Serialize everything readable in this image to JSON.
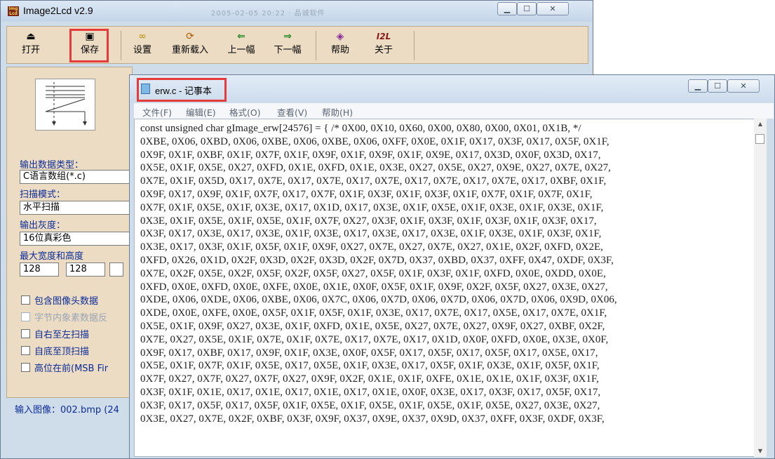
{
  "image2lcd": {
    "title": "Image2Lcd v2.9",
    "title_faded": "2005-02-05 20:22 · 品诚软件",
    "toolbar": [
      {
        "id": "open",
        "label": "打开",
        "icon": "open-icon"
      },
      {
        "id": "save",
        "label": "保存",
        "icon": "save-icon"
      },
      {
        "id": "settings",
        "label": "设置",
        "icon": "glasses-icon"
      },
      {
        "id": "reload",
        "label": "重新载入",
        "icon": "reload-icon"
      },
      {
        "id": "prev",
        "label": "上一幅",
        "icon": "left-arrow-icon"
      },
      {
        "id": "next",
        "label": "下一幅",
        "icon": "right-arrow-icon"
      },
      {
        "id": "help",
        "label": "帮助",
        "icon": "help-icon"
      },
      {
        "id": "about",
        "label": "关于",
        "icon": "about-icon"
      }
    ],
    "about_icon_text": "I2L",
    "fields": {
      "output_type_label": "输出数据类型：",
      "output_type_value": "C语言数组(*.c)",
      "scan_mode_label": "扫描模式：",
      "scan_mode_value": "水平扫描",
      "gray_label": "输出灰度：",
      "gray_value": "16位真彩色",
      "size_label": "最大宽度和高度",
      "width_value": "128",
      "height_value": "128"
    },
    "checkboxes": [
      {
        "label": "包含图像头数据",
        "enabled": true
      },
      {
        "label": "字节内象素数据反",
        "enabled": false
      },
      {
        "label": "自右至左扫描",
        "enabled": true
      },
      {
        "label": "自底至顶扫描",
        "enabled": true
      },
      {
        "label": "高位在前(MSB Fir",
        "enabled": true
      }
    ],
    "status": "输入图像：002.bmp (24"
  },
  "notepad": {
    "title": "erw.c - 记事本",
    "menu": [
      "文件(F)",
      "编辑(E)",
      "格式(O)",
      "查看(V)",
      "帮助(H)"
    ],
    "code_lines": [
      "const unsigned char gImage_erw[24576] = { /* 0X00,0X10,0X60,0X00,0X80,0X00,0X01,0X1B, */",
      "0XBE,0X06,0XBD,0X06,0XBE,0X06,0XBE,0X06,0XFF,0X0E,0X1F,0X17,0X3F,0X17,0X5F,0X1F,",
      "0X9F,0X1F,0XBF,0X1F,0X7F,0X1F,0X9F,0X1F,0X9F,0X1F,0X9E,0X17,0X3D,0X0F,0X3D,0X17,",
      "0X5E,0X1F,0X5E,0X27,0XFD,0X1E,0XFD,0X1E,0X3E,0X27,0X5E,0X27,0X9E,0X27,0X7E,0X27,",
      "0X7E,0X1F,0X5D,0X17,0X7E,0X17,0X7E,0X17,0X7E,0X17,0X7E,0X17,0X7E,0X17,0XBF,0X1F,",
      "0X9F,0X17,0X9F,0X1F,0X7F,0X17,0X7F,0X1F,0X3F,0X1F,0X3F,0X1F,0X7F,0X1F,0X7F,0X1F,",
      "0X7F,0X1F,0X5E,0X1F,0X3E,0X17,0X1D,0X17,0X3E,0X1F,0X5E,0X1F,0X3E,0X1F,0X3E,0X1F,",
      "0X3E,0X1F,0X5E,0X1F,0X5E,0X1F,0X7F,0X27,0X3F,0X1F,0X3F,0X1F,0X3F,0X1F,0X3F,0X17,",
      "0X3F,0X17,0X3E,0X17,0X3E,0X1F,0X3E,0X17,0X3E,0X17,0X3E,0X1F,0X3E,0X1F,0X3F,0X1F,",
      "0X3E,0X17,0X3F,0X1F,0X5F,0X1F,0X9F,0X27,0X7E,0X27,0X7E,0X27,0X1E,0X2F,0XFD,0X2E,",
      "0XFD,0X26,0X1D,0X2F,0X3D,0X2F,0X3D,0X2F,0X7D,0X37,0XBD,0X37,0XFF,0X47,0XDF,0X3F,",
      "0X7E,0X2F,0X5E,0X2F,0X5F,0X2F,0X5F,0X27,0X5F,0X1F,0X3F,0X1F,0XFD,0X0E,0XDD,0X0E,",
      "0XFD,0X0E,0XFD,0X0E,0XFE,0X0E,0X1E,0X0F,0X5F,0X1F,0X9F,0X2F,0X5F,0X27,0X3E,0X27,",
      "0XDE,0X06,0XDE,0X06,0XBE,0X06,0X7C,0X06,0X7D,0X06,0X7D,0X06,0X7D,0X06,0X9D,0X06,",
      "0XDE,0X0E,0XFE,0X0E,0X5F,0X1F,0X5F,0X1F,0X3E,0X17,0X7E,0X17,0X5E,0X17,0X7E,0X1F,",
      "0X5E,0X1F,0X9F,0X27,0X3E,0X1F,0XFD,0X1E,0X5E,0X27,0X7E,0X27,0X9F,0X27,0XBF,0X2F,",
      "0X7E,0X27,0X5E,0X1F,0X7E,0X1F,0X7E,0X17,0X7E,0X17,0X1D,0X0F,0XFD,0X0E,0X3E,0X0F,",
      "0X9F,0X17,0XBF,0X17,0X9F,0X1F,0X3E,0X0F,0X5F,0X17,0X5F,0X17,0X5F,0X17,0X5E,0X17,",
      "0X5E,0X1F,0X7F,0X1F,0X5E,0X17,0X5E,0X1F,0X3E,0X17,0X5F,0X1F,0X3E,0X1F,0X5F,0X1F,",
      "0X7F,0X27,0X7F,0X27,0X7F,0X27,0X9F,0X2F,0X1E,0X1F,0XFE,0X1E,0X1E,0X1F,0X3F,0X1F,",
      "0X3F,0X1F,0X1E,0X17,0X1E,0X17,0X1E,0X17,0X1E,0X0F,0X3E,0X17,0X3F,0X17,0X5F,0X17,",
      "0X3F,0X17,0X5F,0X17,0X5F,0X1F,0X5E,0X1F,0X5E,0X1F,0X5E,0X1F,0X5E,0X27,0X3E,0X27,",
      "0X3E,0X27,0X7E,0X2F,0XBF,0X3F,0X9F,0X37,0X9E,0X37,0X9D,0X37,0XFF,0X3F,0XDF,0X3F,"
    ]
  },
  "colors": {
    "highlight": "#e53b3b",
    "label_blue": "#0b2c99"
  }
}
